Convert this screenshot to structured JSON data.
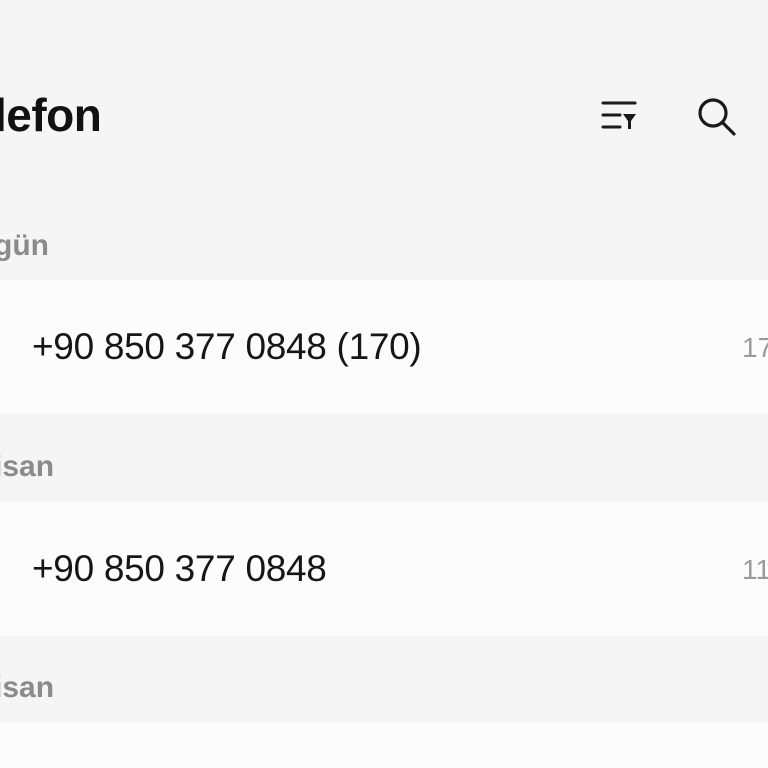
{
  "header": {
    "title": "lefon"
  },
  "toolbar": {
    "filter_icon": "filter-list-icon",
    "search_icon": "search-icon"
  },
  "log": {
    "sections": [
      {
        "label": "gün",
        "entries": [
          {
            "number": "+90 850 377 0848 (170)",
            "time": "17"
          }
        ]
      },
      {
        "label": "isan",
        "entries": [
          {
            "number": "+90 850 377 0848",
            "time": "11"
          }
        ]
      },
      {
        "label": "isan",
        "entries": []
      }
    ]
  },
  "colors": {
    "background": "#f5f5f5",
    "row_background": "#fcfcfc",
    "section_label": "#8b8b8b",
    "primary_text": "#161616",
    "secondary_text": "#9a9a9a"
  }
}
